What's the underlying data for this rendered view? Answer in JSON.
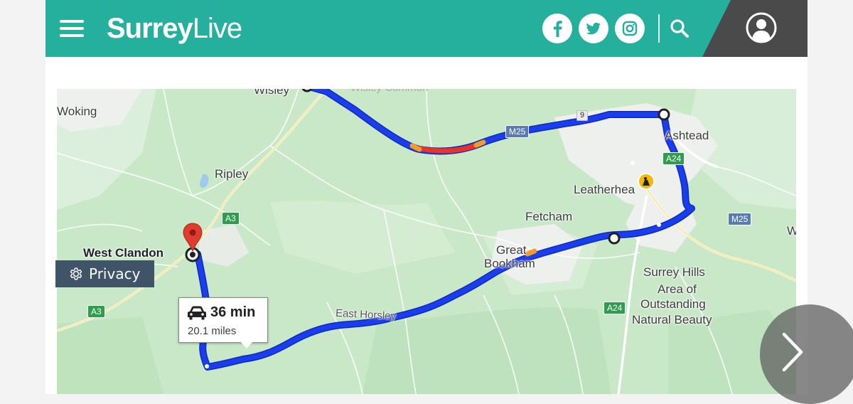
{
  "header": {
    "logo_bold": "Surrey",
    "logo_light": "Live",
    "menu_icon": "hamburger-menu-icon",
    "social": [
      "facebook-icon",
      "twitter-icon",
      "instagram-icon"
    ],
    "search_icon": "search-icon",
    "account_icon": "user-account-icon",
    "brand_color": "#24b09c",
    "account_bg": "#4a4a4a"
  },
  "map": {
    "place_labels": {
      "wisley": "Wisley",
      "woking": "Woking",
      "ripley": "Ripley",
      "ashtead": "Ashtead",
      "leatherhead": "Leatherhea",
      "fetcham": "Fetcham",
      "great": "Great",
      "bookham": "Bookham",
      "west_clandon": "West Clandon",
      "east_horsley": "East Horsley",
      "surrey_hills": "Surrey Hills",
      "aonb_line2": "Area of",
      "aonb_line3": "Outstanding",
      "aonb_line4": "Natural Beauty",
      "edge_w": "W",
      "junction_9": "9"
    },
    "road_shields": {
      "m25_top": "M25",
      "m25_right": "M25",
      "a24_top": "A24",
      "a24_bottom": "A24",
      "a3_top": "A3",
      "a3_left": "A3"
    },
    "route_info": {
      "time": "36 min",
      "distance": "20.1 miles",
      "mode_icon": "car-icon"
    },
    "colors": {
      "route": "#1a3df0",
      "traffic_heavy": "#e8322a",
      "traffic_medium": "#f29b26",
      "land": "#c9e8c8",
      "urban": "#eef0ee"
    }
  },
  "privacy_button": {
    "label": "Privacy",
    "icon": "gear-icon"
  },
  "next_button": {
    "icon": "chevron-right-icon"
  }
}
